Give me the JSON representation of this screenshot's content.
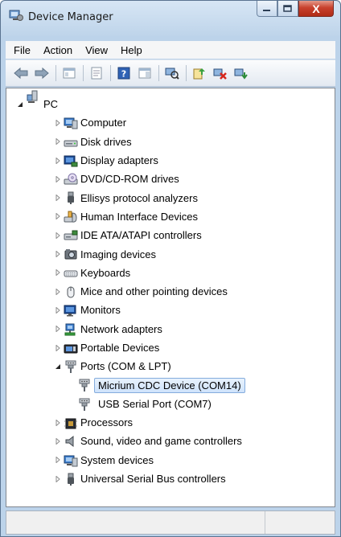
{
  "window": {
    "title": "Device Manager"
  },
  "caption": {
    "close_glyph": "X"
  },
  "menu": [
    "File",
    "Action",
    "View",
    "Help"
  ],
  "toolbar": {
    "buttons": [
      "back-icon",
      "forward-icon",
      "show-hide-console-tree-icon",
      "properties-icon",
      "help-icon",
      "action-pane-icon",
      "scan-hardware-changes-icon",
      "update-driver-icon",
      "disable-device-icon",
      "uninstall-device-icon"
    ]
  },
  "tree": {
    "root": "PC",
    "nodes": [
      {
        "label": "Computer",
        "icon": "computer-icon"
      },
      {
        "label": "Disk drives",
        "icon": "disk-drive-icon"
      },
      {
        "label": "Display adapters",
        "icon": "display-adapter-icon"
      },
      {
        "label": "DVD/CD-ROM drives",
        "icon": "dvd-drive-icon"
      },
      {
        "label": "Ellisys protocol analyzers",
        "icon": "usb-plug-icon"
      },
      {
        "label": "Human Interface Devices",
        "icon": "hid-icon"
      },
      {
        "label": "IDE ATA/ATAPI controllers",
        "icon": "ide-controller-icon"
      },
      {
        "label": "Imaging devices",
        "icon": "imaging-device-icon"
      },
      {
        "label": "Keyboards",
        "icon": "keyboard-icon"
      },
      {
        "label": "Mice and other pointing devices",
        "icon": "mouse-icon"
      },
      {
        "label": "Monitors",
        "icon": "monitor-icon"
      },
      {
        "label": "Network adapters",
        "icon": "network-adapter-icon"
      },
      {
        "label": "Portable Devices",
        "icon": "portable-device-icon"
      },
      {
        "label": "Ports (COM & LPT)",
        "icon": "port-icon",
        "expanded": true,
        "children": [
          {
            "label": "Micrium CDC Device (COM14)",
            "icon": "port-icon",
            "selected": true
          },
          {
            "label": "USB Serial Port (COM7)",
            "icon": "port-icon"
          }
        ]
      },
      {
        "label": "Processors",
        "icon": "processor-icon"
      },
      {
        "label": "Sound, video and game controllers",
        "icon": "speaker-icon"
      },
      {
        "label": "System devices",
        "icon": "system-device-icon"
      },
      {
        "label": "Universal Serial Bus controllers",
        "icon": "usb-plug-icon"
      }
    ]
  },
  "status": {
    "left": "",
    "right": ""
  }
}
